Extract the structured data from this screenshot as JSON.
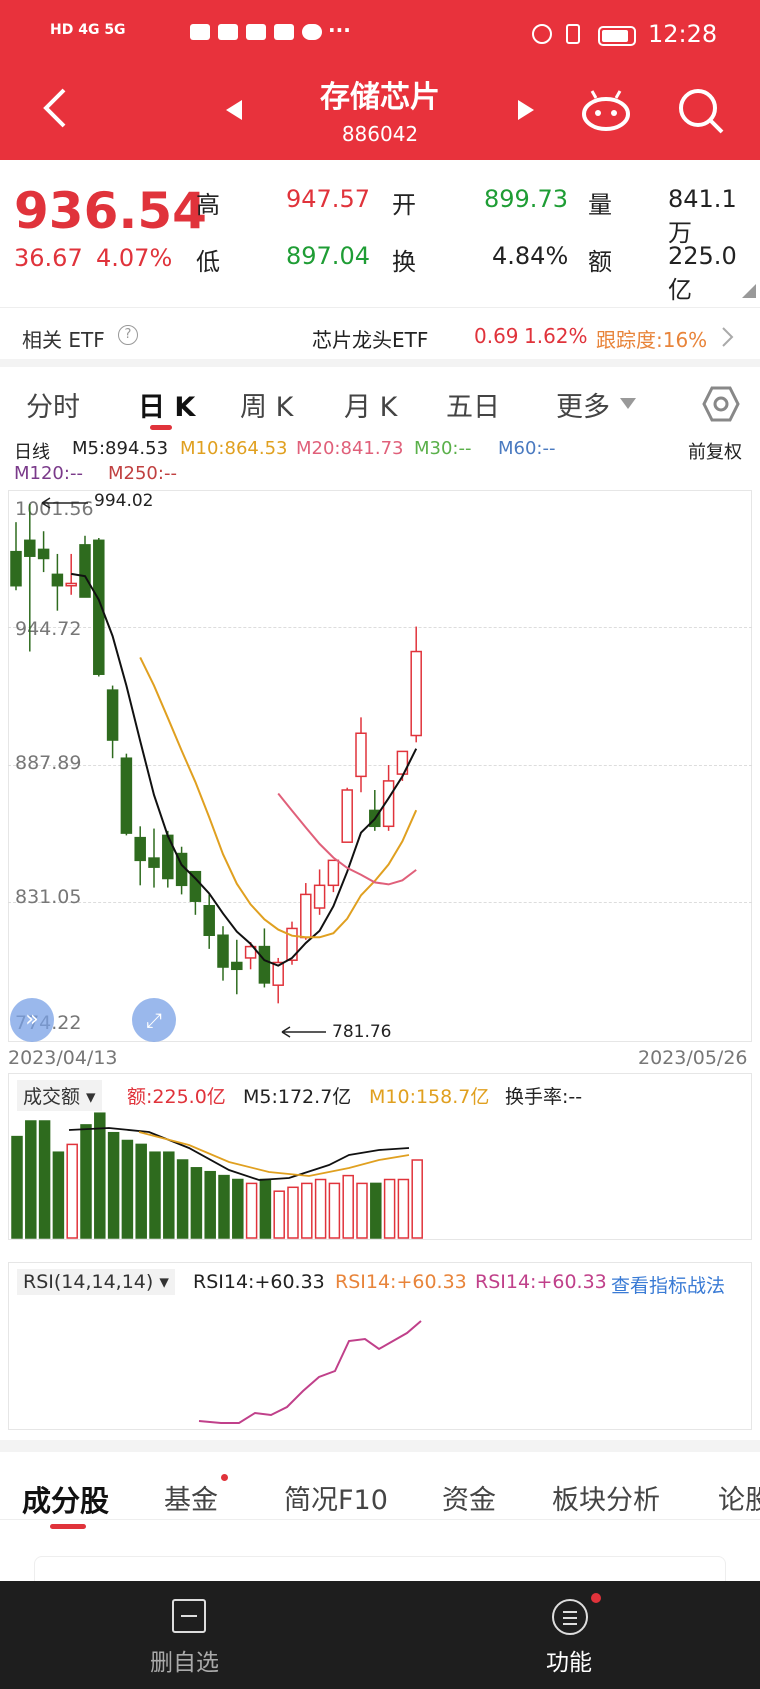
{
  "status_bar": {
    "signal_left": "HD 4G 5G",
    "time": "12:28"
  },
  "header": {
    "title": "存储芯片",
    "code": "886042"
  },
  "quote": {
    "price": "936.54",
    "change": "36.67",
    "change_pct": "4.07%",
    "high_label": "高",
    "high": "947.57",
    "low_label": "低",
    "low": "897.04",
    "open_label": "开",
    "open": "899.73",
    "turnover_label": "换",
    "turnover": "4.84%",
    "volume_label": "量",
    "volume": "841.1万",
    "amount_label": "额",
    "amount": "225.0亿"
  },
  "etf": {
    "label": "相关 ETF",
    "name": "芯片龙头ETF",
    "price": "0.69",
    "pct": "1.62%",
    "track": "跟踪度:16%"
  },
  "tabs": [
    {
      "label": "分时"
    },
    {
      "label": "日 K"
    },
    {
      "label": "周 K"
    },
    {
      "label": "月 K"
    },
    {
      "label": "五日"
    },
    {
      "label": "更多"
    }
  ],
  "ma": {
    "title": "日线",
    "m5": "M5:894.53",
    "m10": "M10:864.53",
    "m20": "M20:841.73",
    "m30": "M30:--",
    "m60": "M60:--",
    "m120": "M120:--",
    "m250": "M250:--",
    "adj": "前复权"
  },
  "chart_data": {
    "type": "candlestick",
    "y_ticks": [
      "1001.56",
      "944.72",
      "887.89",
      "831.05",
      "774.22"
    ],
    "ylim": [
      774.22,
      1001.56
    ],
    "x_start": "2023/04/13",
    "x_end": "2023/05/26",
    "max_label": "994.02",
    "min_label": "781.76",
    "candles": [
      {
        "o": 981,
        "h": 994,
        "l": 964,
        "c": 966
      },
      {
        "o": 986,
        "h": 1002,
        "l": 937,
        "c": 979
      },
      {
        "o": 982,
        "h": 990,
        "l": 972,
        "c": 978
      },
      {
        "o": 971,
        "h": 980,
        "l": 955,
        "c": 966
      },
      {
        "o": 966,
        "h": 980,
        "l": 962,
        "c": 967
      },
      {
        "o": 984,
        "h": 988,
        "l": 961,
        "c": 961
      },
      {
        "o": 986,
        "h": 987,
        "l": 926,
        "c": 927
      },
      {
        "o": 920,
        "h": 922,
        "l": 890,
        "c": 898
      },
      {
        "o": 890,
        "h": 892,
        "l": 856,
        "c": 857
      },
      {
        "o": 855,
        "h": 860,
        "l": 834,
        "c": 845
      },
      {
        "o": 846,
        "h": 859,
        "l": 833,
        "c": 842
      },
      {
        "o": 856,
        "h": 858,
        "l": 833,
        "c": 837
      },
      {
        "o": 848,
        "h": 851,
        "l": 830,
        "c": 834
      },
      {
        "o": 840,
        "h": 840,
        "l": 821,
        "c": 827
      },
      {
        "o": 825,
        "h": 830,
        "l": 806,
        "c": 812
      },
      {
        "o": 812,
        "h": 816,
        "l": 792,
        "c": 798
      },
      {
        "o": 800,
        "h": 810,
        "l": 786,
        "c": 797
      },
      {
        "o": 802,
        "h": 809,
        "l": 797,
        "c": 807
      },
      {
        "o": 807,
        "h": 815,
        "l": 789,
        "c": 791
      },
      {
        "o": 790,
        "h": 802,
        "l": 782,
        "c": 800
      },
      {
        "o": 801,
        "h": 818,
        "l": 799,
        "c": 815
      },
      {
        "o": 811,
        "h": 835,
        "l": 810,
        "c": 830
      },
      {
        "o": 824,
        "h": 841,
        "l": 821,
        "c": 834
      },
      {
        "o": 834,
        "h": 845,
        "l": 831,
        "c": 845
      },
      {
        "o": 853,
        "h": 877,
        "l": 853,
        "c": 876
      },
      {
        "o": 882,
        "h": 908,
        "l": 875,
        "c": 901
      },
      {
        "o": 867,
        "h": 876,
        "l": 858,
        "c": 860
      },
      {
        "o": 860,
        "h": 887,
        "l": 858,
        "c": 880
      },
      {
        "o": 883,
        "h": 893,
        "l": 880,
        "c": 893
      },
      {
        "o": 900,
        "h": 948,
        "l": 897,
        "c": 937
      }
    ]
  },
  "volume": {
    "selector": "成交额",
    "amount": "额:225.0亿",
    "m5": "M5:172.7亿",
    "m10": "M10:158.7亿",
    "turnover": "换手率:--"
  },
  "rsi": {
    "selector": "RSI(14,14,14)",
    "r1": "RSI14:+60.33",
    "r2": "RSI14:+60.33",
    "r3": "RSI14:+60.33",
    "link": "查看指标战法"
  },
  "subtabs": [
    {
      "label": "成分股"
    },
    {
      "label": "基金"
    },
    {
      "label": "简况F10"
    },
    {
      "label": "资金"
    },
    {
      "label": "板块分析"
    },
    {
      "label": "论股"
    }
  ],
  "bottom": {
    "remove_label": "删自选",
    "func_label": "功能"
  },
  "colors": {
    "up": "#e0333b",
    "down": "#2e6b1e",
    "header": "#e8323c"
  }
}
